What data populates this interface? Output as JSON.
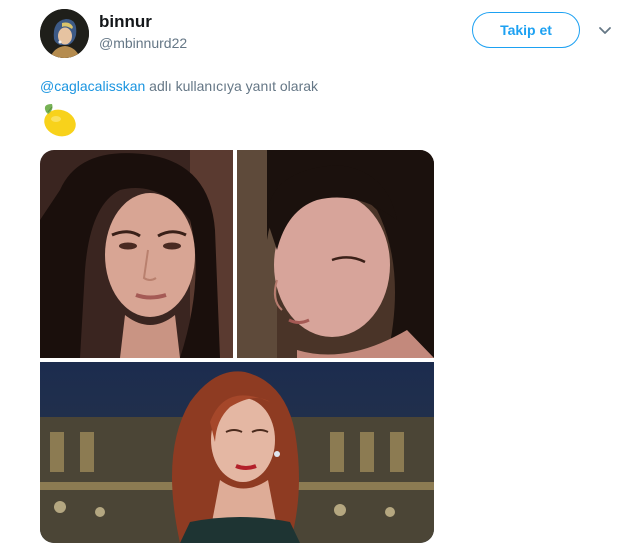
{
  "author": {
    "display_name": "binnur",
    "handle": "@mbinnurd22"
  },
  "follow_button": {
    "label": "Takip et"
  },
  "reply_context": {
    "mention": "@caglacalisskan",
    "suffix": " adlı kullanıcıya yanıt olarak"
  },
  "tweet": {
    "emoji_icon": "lemon-icon"
  },
  "media": {
    "photos": [
      {
        "name": "photo-woman-dark-hair-front"
      },
      {
        "name": "photo-woman-dark-hair-looking-down"
      },
      {
        "name": "photo-woman-red-hair"
      }
    ]
  },
  "colors": {
    "accent": "#1da1f2",
    "mention": "#1b95e0",
    "secondary_text": "#657786"
  }
}
